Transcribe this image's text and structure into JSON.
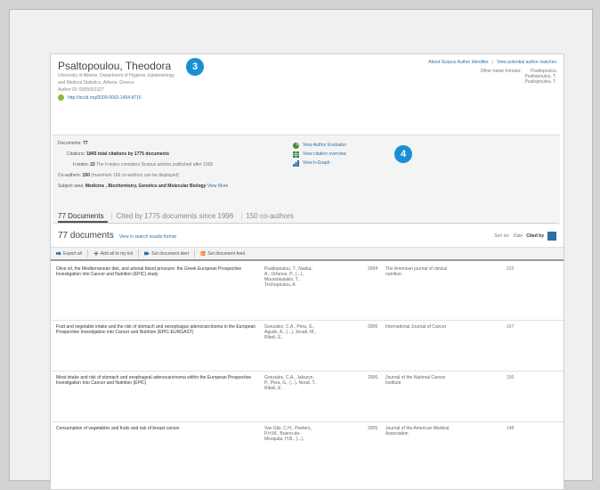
{
  "author": {
    "name": "Psaltopoulou, Theodora",
    "affiliation": [
      "University of Athens, Department of Hygiene, Epidemiology",
      "and Medical Statistics, Athens, Greece"
    ],
    "author_id": "Author ID: 6505652327",
    "orcid": "http://orcid.org/0000-0002-1404-8716"
  },
  "badges": {
    "b3": "3",
    "b4": "4"
  },
  "top_links": {
    "about": "About Scopus Author Identifier",
    "potential": "View potential author matches"
  },
  "other_formats": {
    "label": "Other name formats:",
    "names": [
      "Psaltopoulou",
      "Psaltopoulou, T.",
      "Psaltopoulou, T."
    ]
  },
  "metrics": {
    "documents_label": "Documents:",
    "documents_value": "77",
    "citations_label": "Citations:",
    "citations_value": "1845 total citations by 1775 documents",
    "hindex_label": "h-index:",
    "hindex_value": "22",
    "hindex_note": "The h-index considers Scopus articles published after 1995",
    "coauthors_label": "Co-authors:",
    "coauthors_value": "150",
    "coauthors_note": "(maximum 150 co-authors can be displayed)",
    "subject_label": "Subject area:",
    "subject_value": "Medicine , Biochemistry, Genetics and Molecular Biology",
    "view_more": "View More"
  },
  "tools": [
    {
      "label": "View Author Evaluator",
      "icon": "pie-chart-icon"
    },
    {
      "label": "View citation overview",
      "icon": "table-icon"
    },
    {
      "label": "View h-Graph",
      "icon": "bar-chart-icon"
    }
  ],
  "tabs": [
    "77 Documents",
    "Cited by 1775 documents since 1996",
    "150 co-authors"
  ],
  "results": {
    "count": "77 documents",
    "view_search": "View in search results format"
  },
  "sort": {
    "label": "Sort on:",
    "options": [
      "Date",
      "Cited by"
    ]
  },
  "toolbar": {
    "export": "Export all",
    "add": "Add all to my list",
    "alert": "Set document alert",
    "feed": "Set document feed"
  },
  "colors": {
    "accent": "#1a8fd6",
    "link": "#2f6fa6",
    "rss": "#e8731c",
    "orcid": "#8fb93e"
  },
  "documents": [
    {
      "title": "Olive oil, the Mediterranean diet, and arterial blood pressure: the Greek European Prospective Investigation into Cancer and Nutrition (EPIC) study",
      "authors": [
        "Psaltopoulou, T., Naska,",
        "A., Orfanos, P., (...),",
        "Mountokalakis, T.,",
        "Trichopoulou, A."
      ],
      "year": "2004",
      "journal": "The American journal of clinical nutrition",
      "cited": "222"
    },
    {
      "title": "Fruit and vegetable intake and the risk of stomach and oesophagus adenocarcinoma in the European Prospective Investigation into Cancer and Nutrition (EPIC-EURGAST)",
      "authors": [
        "Gonzalez, C.A., Pera, G.,",
        "Agudo, A., (...), Jenab, M.,",
        "Riboli, E."
      ],
      "year": "2006",
      "journal": "International Journal of Cancer",
      "cited": "167"
    },
    {
      "title": "Meat intake and risk of stomach and esophageal adenocarcinoma within the European Prospective Investigation Into Cancer and Nutrition (EPIC)",
      "authors": [
        "Gonzalez, C.A., Jakszyn,",
        "P., Pera, G., (...), Norat, T.,",
        "Riboli, E."
      ],
      "year": "2006",
      "journal": "Journal of the National Cancer Institute",
      "cited": "150"
    },
    {
      "title": "Consumption of vegetables and fruits and risk of breast cancer",
      "authors": [
        "Van Gils, C.H., Peeters,",
        "P.H.M., Bueno-de-",
        "Mesquita, H.B., (...),"
      ],
      "year": "2005",
      "journal": "Journal of the American Medical Association",
      "cited": "148"
    }
  ]
}
